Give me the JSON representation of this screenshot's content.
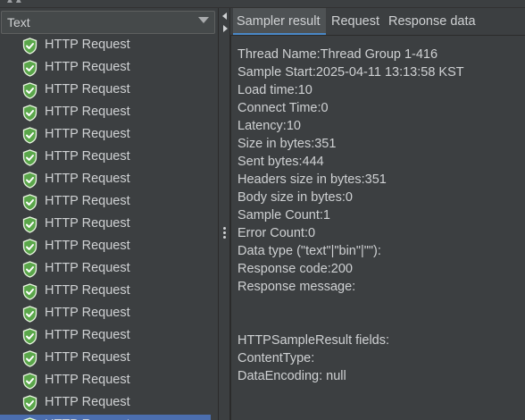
{
  "renderer": {
    "selected": "Text"
  },
  "tree": {
    "items": [
      {
        "label": "HTTP Request",
        "status": "success"
      },
      {
        "label": "HTTP Request",
        "status": "success"
      },
      {
        "label": "HTTP Request",
        "status": "success"
      },
      {
        "label": "HTTP Request",
        "status": "success"
      },
      {
        "label": "HTTP Request",
        "status": "success"
      },
      {
        "label": "HTTP Request",
        "status": "success"
      },
      {
        "label": "HTTP Request",
        "status": "success"
      },
      {
        "label": "HTTP Request",
        "status": "success"
      },
      {
        "label": "HTTP Request",
        "status": "success"
      },
      {
        "label": "HTTP Request",
        "status": "success"
      },
      {
        "label": "HTTP Request",
        "status": "success"
      },
      {
        "label": "HTTP Request",
        "status": "success"
      },
      {
        "label": "HTTP Request",
        "status": "success"
      },
      {
        "label": "HTTP Request",
        "status": "success"
      },
      {
        "label": "HTTP Request",
        "status": "success"
      },
      {
        "label": "HTTP Request",
        "status": "success"
      },
      {
        "label": "HTTP Request",
        "status": "success"
      },
      {
        "label": "HTTP Request",
        "status": "success",
        "selected": true
      }
    ],
    "icon": "green-shield-check-icon",
    "selection_color": "#4b6eaf"
  },
  "tabs": [
    {
      "label": "Sampler result",
      "active": true
    },
    {
      "label": "Request",
      "active": false
    },
    {
      "label": "Response data",
      "active": false
    }
  ],
  "sampler_result": {
    "lines": [
      "Thread Name:Thread Group 1-416",
      "Sample Start:2025-04-11 13:13:58 KST",
      "Load time:10",
      "Connect Time:0",
      "Latency:10",
      "Size in bytes:351",
      "Sent bytes:444",
      "Headers size in bytes:351",
      "Body size in bytes:0",
      "Sample Count:1",
      "Error Count:0",
      "Data type (\"text\"|\"bin\"|\"\"):",
      "Response code:200",
      "Response message:",
      "",
      "",
      "HTTPSampleResult fields:",
      "ContentType:",
      "DataEncoding: null"
    ]
  },
  "colors": {
    "background": "#3c3f41",
    "text": "#cfd1d3",
    "accent": "#4a88c7",
    "success_icon": "#4caf50"
  }
}
